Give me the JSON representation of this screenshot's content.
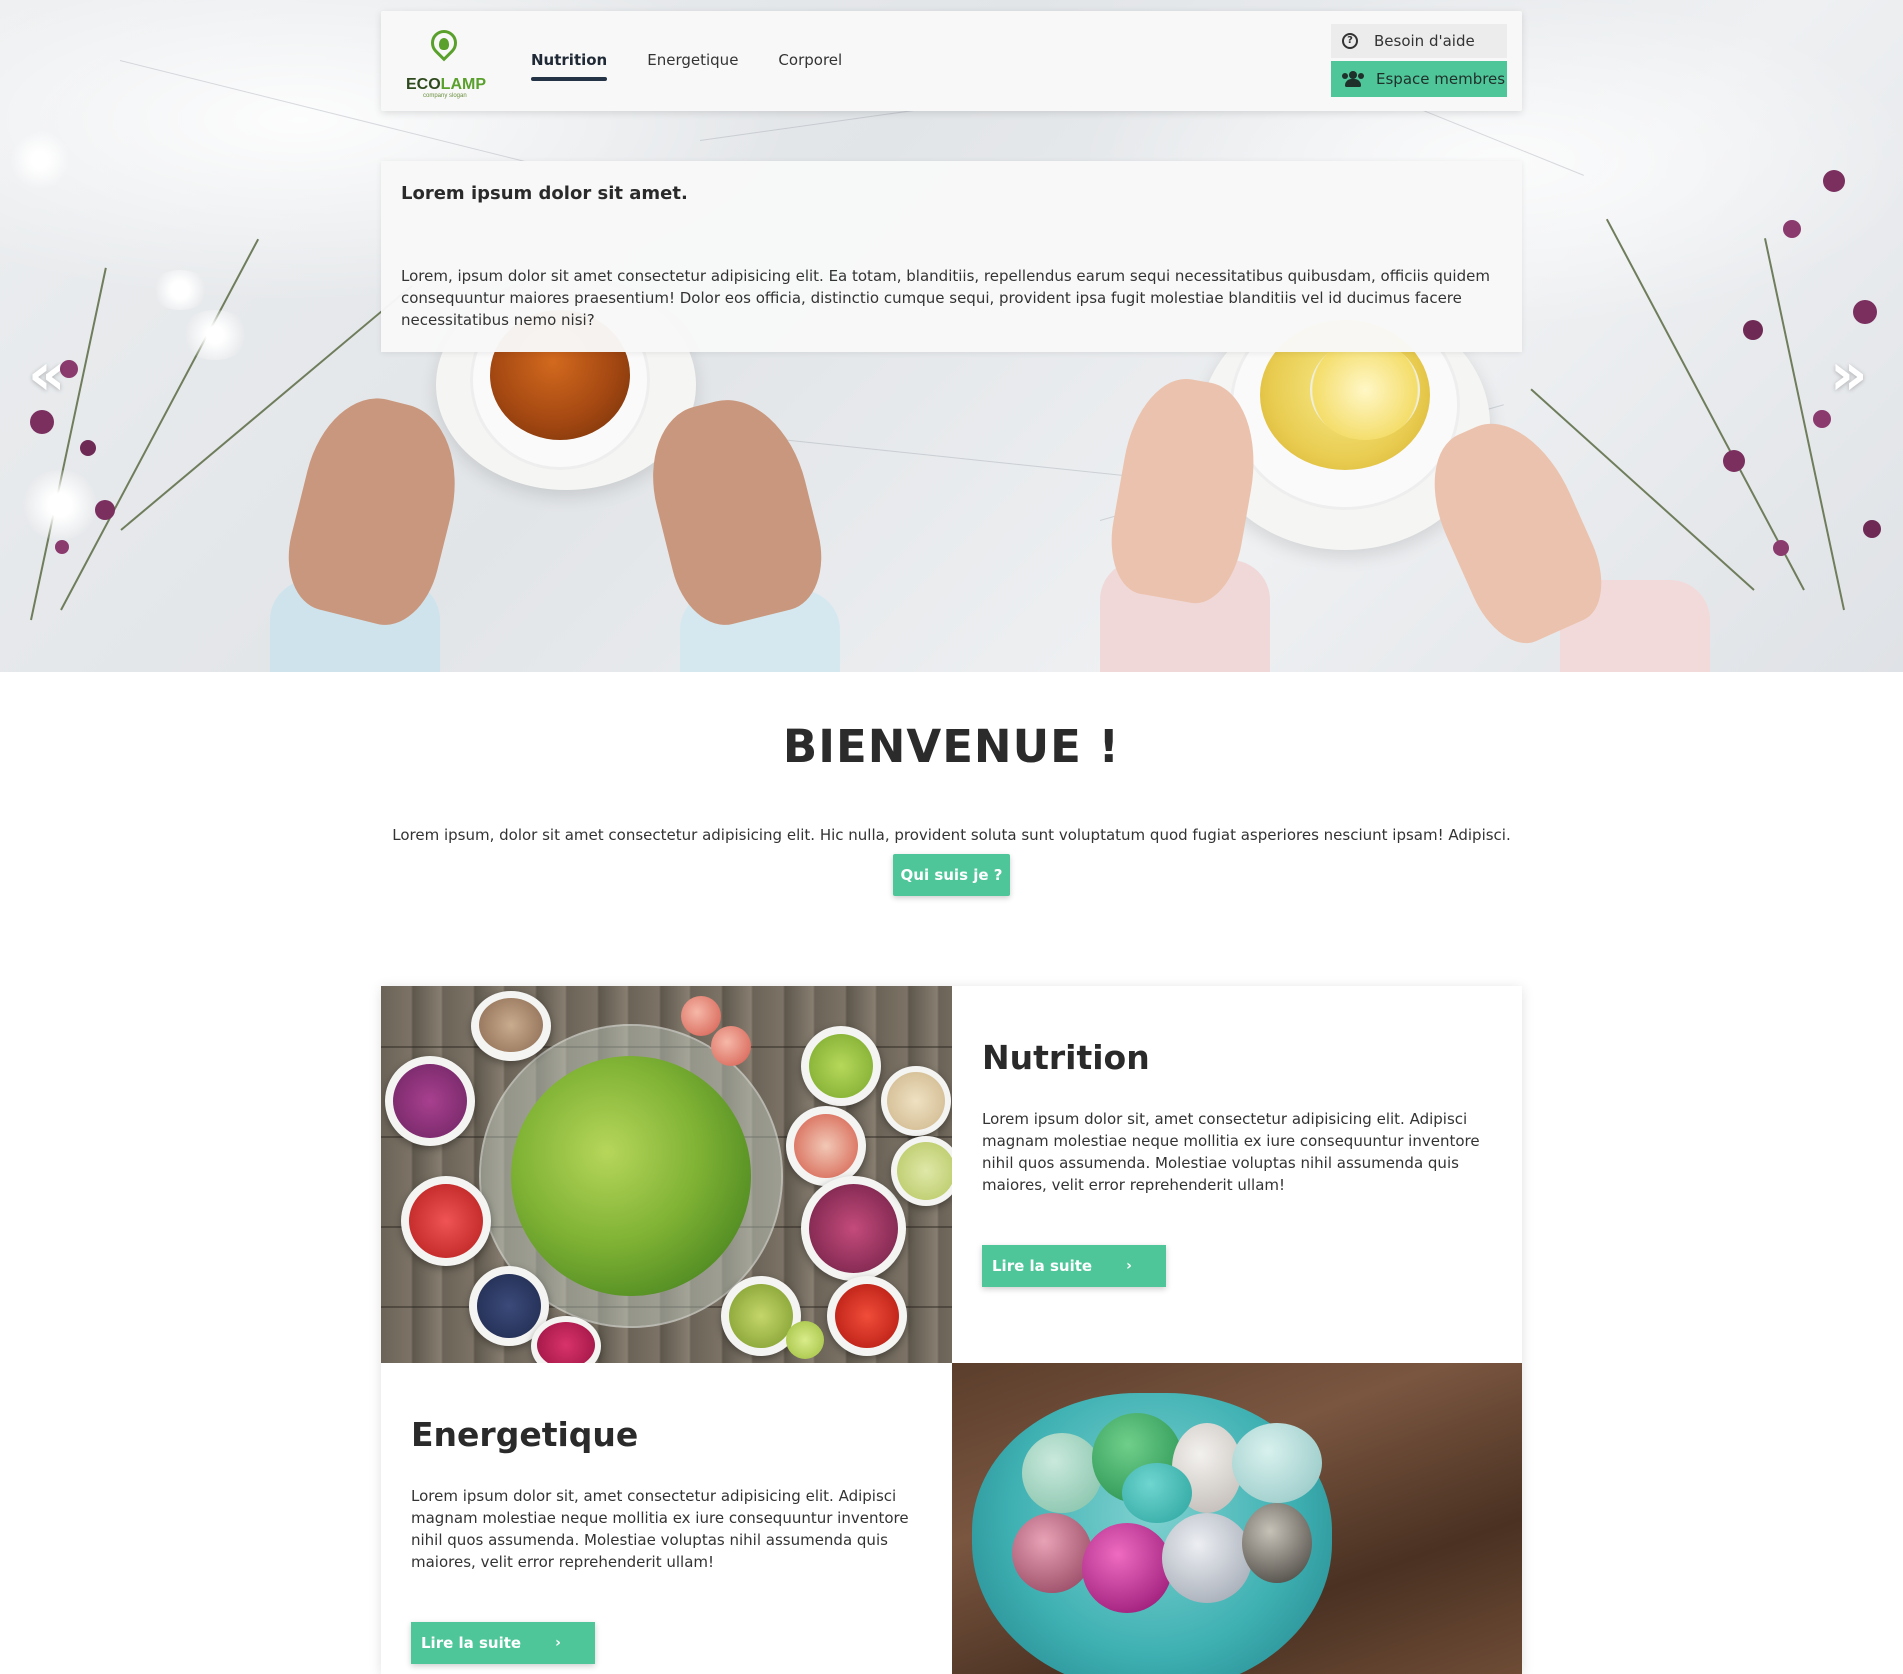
{
  "brand": {
    "logo_main": "ECO",
    "logo_accent": "LAMP",
    "logo_tagline": "company slogan"
  },
  "nav": {
    "items": [
      {
        "label": "Nutrition",
        "active": true
      },
      {
        "label": "Energetique",
        "active": false
      },
      {
        "label": "Corporel",
        "active": false
      }
    ]
  },
  "header_buttons": {
    "help_label": "Besoin d'aide",
    "members_label": "Espace membres",
    "help_icon": "question-circle-icon",
    "members_icon": "users-icon"
  },
  "hero": {
    "title": "Lorem ipsum dolor sit amet.",
    "text": "Lorem, ipsum dolor sit amet consectetur adipisicing elit. Ea totam, blanditiis, repellendus earum sequi necessitatibus quibusdam, officiis quidem consequuntur maiores praesentium! Dolor eos officia, distinctio cumque sequi, provident ipsa fugit molestiae blanditiis vel id ducimus facere necessitatibus nemo nisi?",
    "prev_arrow": "«",
    "next_arrow": "»"
  },
  "welcome": {
    "title": "BIENVENUE !",
    "text": "Lorem ipsum, dolor sit amet consectetur adipisicing elit. Hic nulla, provident soluta sunt voluptatum quod fugiat asperiores nesciunt ipsam! Adipisci.",
    "button_label": "Qui suis je ?"
  },
  "sections": [
    {
      "title": "Nutrition",
      "text": "Lorem ipsum dolor sit, amet consectetur adipisicing elit. Adipisci magnam molestiae neque mollitia ex iure consequuntur inventore nihil quos assumenda. Molestiae voluptas nihil assumenda quis maiores, velit error reprehenderit ullam!",
      "button_label": "Lire la suite",
      "button_icon": "chevron-right-icon"
    },
    {
      "title": "Energetique",
      "text": "Lorem ipsum dolor sit, amet consectetur adipisicing elit. Adipisci magnam molestiae neque mollitia ex iure consequuntur inventore nihil quos assumenda. Molestiae voluptas nihil assumenda quis maiores, velit error reprehenderit ullam!",
      "button_label": "Lire la suite",
      "button_icon": "chevron-right-icon"
    }
  ],
  "colors": {
    "accent": "#4fc69a",
    "nav_underline": "#243446",
    "logo_green": "#5aa02c"
  }
}
